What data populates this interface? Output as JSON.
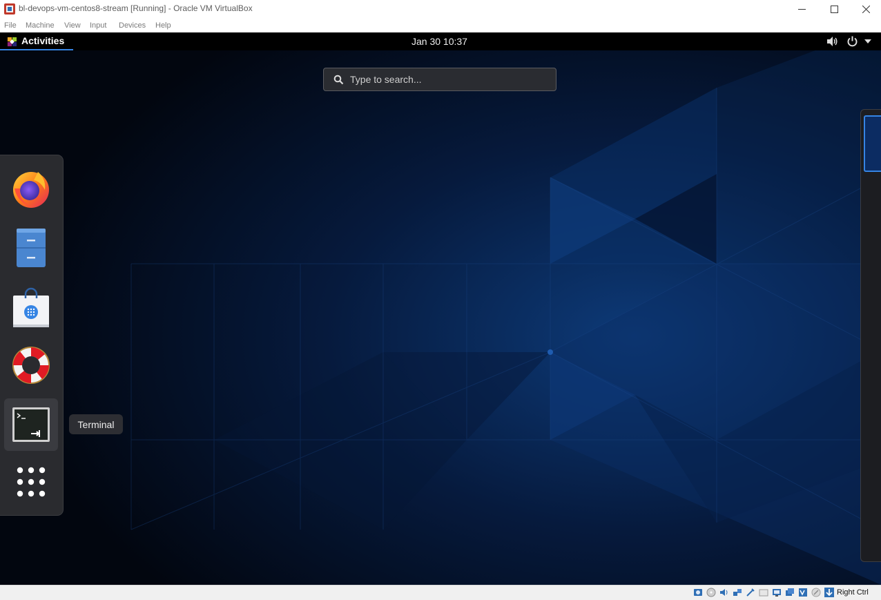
{
  "window": {
    "title": "bl-devops-vm-centos8-stream [Running] - Oracle VM VirtualBox",
    "minimize_glyph": "—",
    "maximize_glyph": "☐",
    "close_glyph": "✕"
  },
  "menubar": {
    "items": [
      "File",
      "Machine",
      "View",
      "Input",
      "Devices",
      "Help"
    ]
  },
  "guest": {
    "topbar": {
      "activities_label": "Activities",
      "clock": "Jan 30  10:37",
      "tray_icons": [
        "volume-icon",
        "power-icon",
        "dropdown-arrow-icon"
      ]
    },
    "search": {
      "placeholder": "Type to search..."
    },
    "dash": {
      "apps": [
        "firefox-icon",
        "files-icon",
        "software-icon",
        "help-icon",
        "terminal-icon",
        "show-applications-icon"
      ],
      "hovered_app": "Terminal",
      "tooltip": "Terminal"
    }
  },
  "statusbar": {
    "icons": [
      "hard-disk-icon",
      "optical-drive-icon",
      "audio-icon",
      "network-icon",
      "usb-icon",
      "shared-folders-icon",
      "display-icon",
      "recording-icon",
      "cpu-icon",
      "mouse-integration-icon",
      "host-key-arrow-icon"
    ],
    "host_key": "Right Ctrl"
  },
  "colors": {
    "accent": "#3584e4",
    "topbar_bg": "#000000",
    "dash_bg": "#2a2b2f",
    "desktop_bg": "#02060f"
  }
}
